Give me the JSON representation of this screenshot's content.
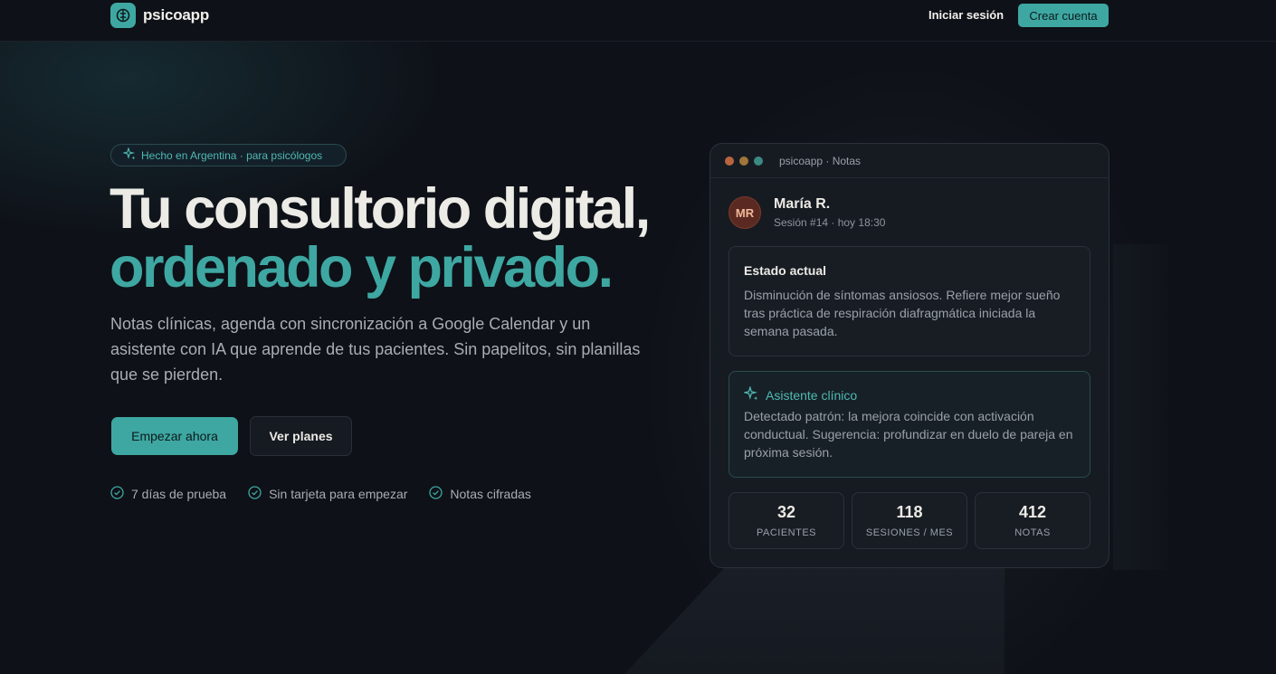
{
  "nav": {
    "brand": "psicoapp",
    "login_label": "Iniciar sesión",
    "signup_label": "Crear cuenta"
  },
  "hero": {
    "badge": "Hecho en Argentina · para psicólogos",
    "title_line1": "Tu consultorio digital,",
    "title_line2": "ordenado y privado.",
    "lead": "Notas clínicas, agenda con sincronización a Google Calendar y un asistente con IA que aprende de tus pacientes. Sin papelitos, sin planillas que se pierden.",
    "cta_primary": "Empezar ahora",
    "cta_secondary": "Ver planes",
    "checks": [
      "7 días de prueba",
      "Sin tarjeta para empezar",
      "Notas cifradas"
    ]
  },
  "preview": {
    "window_title": "psicoapp · Notas",
    "patient_initials": "MR",
    "patient_name": "María R.",
    "session_info": "Sesión #14 · hoy 18:30",
    "estado_title": "Estado actual",
    "estado_text": "Disminución de síntomas ansiosos. Refiere mejor sueño tras práctica de respiración diafragmática iniciada la semana pasada.",
    "ai_title": "Asistente clínico",
    "ai_text": "Detectado patrón: la mejora coincide con activación conductual. Sugerencia: profundizar en duelo de pareja en próxima sesión.",
    "stats": [
      {
        "value": "32",
        "label": "PACIENTES"
      },
      {
        "value": "118",
        "label": "SESIONES / MES"
      },
      {
        "value": "412",
        "label": "NOTAS"
      }
    ]
  },
  "colors": {
    "accent": "#3ea7a2",
    "background": "#0e1117",
    "dot_red": "#b8643e",
    "dot_yellow": "#a0763a",
    "dot_green": "#3a8a82"
  }
}
